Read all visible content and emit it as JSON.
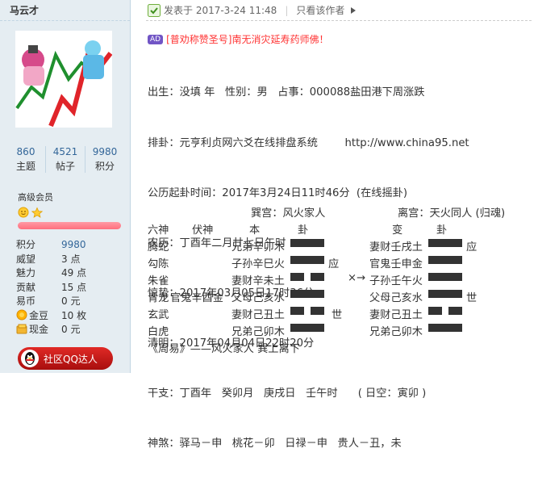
{
  "user": {
    "name": "马云才",
    "stats": [
      {
        "num": "860",
        "label": "主题"
      },
      {
        "num": "4521",
        "label": "帖子"
      },
      {
        "num": "9980",
        "label": "积分"
      }
    ],
    "rank": "高级会员",
    "profile": [
      {
        "label": "积分",
        "value": "9980",
        "blue": true
      },
      {
        "label": "威望",
        "value": "3 点"
      },
      {
        "label": "魅力",
        "value": "49 点"
      },
      {
        "label": "贡献",
        "value": "15 点"
      },
      {
        "label": "易币",
        "value": "0 元"
      },
      {
        "label": "金豆",
        "value": "10 枚",
        "icon": "gold-coin-icon"
      },
      {
        "label": "现金",
        "value": "0 元",
        "icon": "cash-icon"
      }
    ],
    "qq_button": "社区QQ达人"
  },
  "header": {
    "posted": "发表于 2017-3-24 11:48",
    "author_only": "只看该作者"
  },
  "ad": {
    "tag": "AD",
    "text": "[普劝称赞圣号]南无消灾延寿药师佛！"
  },
  "post_lines": [
    "出生：没填 年   性别：男   占事：000088盐田港下周涨跌",
    "排卦：元亨利贞网六爻在线排盘系统        http://www.china95.net",
    "公历起卦时间：2017年3月24日11时46分  (在线摇卦)",
    "农历：丁酉年二月廿七日午时",
    "惊蛰：2017年03月05日17时36分",
    "清明：2017年04月04日22时20分",
    "干支：丁酉年   癸卯月   庚戌日   壬午时      ( 日空：寅卯 )",
    "神煞：驿马－申   桃花－卯   日禄－申   贵人－丑，未"
  ],
  "gua": {
    "palace_left": "巽宫：风火家人",
    "palace_right": "离宫：天火同人 (归魂)",
    "headers": [
      "六神",
      "伏神",
      "本",
      "卦",
      "变",
      "卦"
    ],
    "rows": [
      {
        "shen": "腾蛇",
        "fu": "",
        "ben": "兄弟辛卯木",
        "ben_mark": "",
        "move": "",
        "bian": "妻财壬戌土",
        "bian_mark": "应"
      },
      {
        "shen": "勾陈",
        "fu": "",
        "ben": "子孙辛巳火",
        "ben_mark": "应",
        "move": "",
        "bian": "官鬼壬申金",
        "bian_mark": ""
      },
      {
        "shen": "朱雀",
        "fu": "",
        "ben": "妻财辛未土",
        "ben_mark": "",
        "move": "×→",
        "bian": "子孙壬午火",
        "bian_mark": ""
      },
      {
        "shen": "青龙",
        "fu": "官鬼辛酉金",
        "ben": "父母己亥水",
        "ben_mark": "",
        "move": "",
        "bian": "父母己亥水",
        "bian_mark": "世"
      },
      {
        "shen": "玄武",
        "fu": "",
        "ben": "妻财己丑土",
        "ben_mark": "世",
        "move": "",
        "bian": "妻财己丑土",
        "bian_mark": ""
      },
      {
        "shen": "白虎",
        "fu": "",
        "ben": "兄弟己卯木",
        "ben_mark": "",
        "move": "",
        "bian": "兄弟己卯木",
        "bian_mark": ""
      }
    ],
    "footer": "《周易》——风火家人 巽上离下"
  },
  "colors": {
    "sidebar_bg": "#e5edf2",
    "link_blue": "#336699",
    "ad_red": "#ff3333",
    "qq_red": "#c8191a"
  }
}
